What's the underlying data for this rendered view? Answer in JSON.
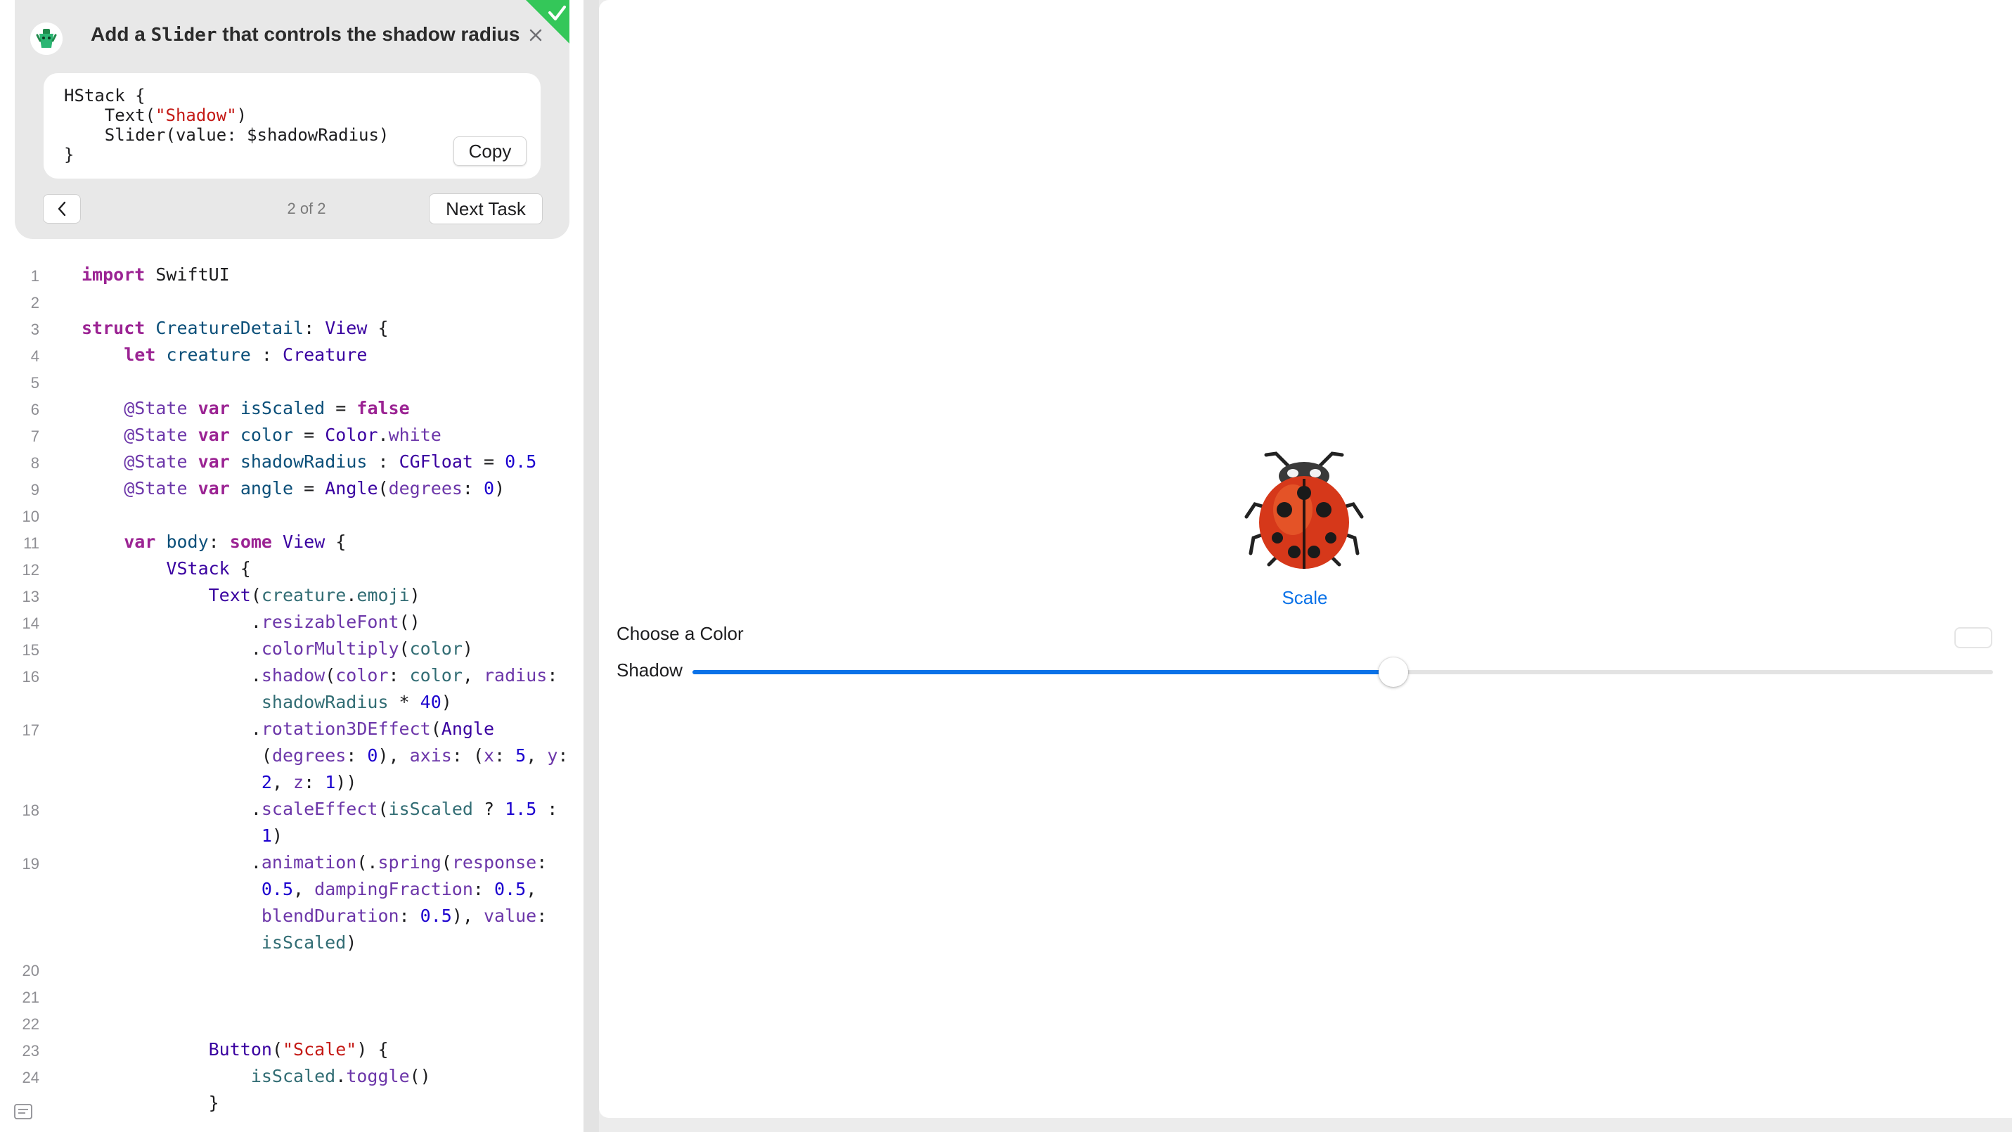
{
  "task": {
    "title_prefix": "Add a ",
    "title_code": "Slider",
    "title_suffix": " that controls the shadow radius",
    "snippet": {
      "line1": "HStack {",
      "line2_pre": "    Text(",
      "line2_str": "\"Shadow\"",
      "line2_post": ")",
      "line3": "    Slider(value: $shadowRadius)",
      "line4": "}"
    },
    "copy_label": "Copy",
    "page_indicator": "2 of 2",
    "next_label": "Next Task",
    "icons": {
      "task": "mascot-icon",
      "close": "close-icon",
      "badge": "checkmark-icon",
      "back": "chevron-left-icon"
    }
  },
  "editor": {
    "line_numbers": [
      "1",
      "2",
      "3",
      "4",
      "5",
      "6",
      "7",
      "8",
      "9",
      "10",
      "11",
      "12",
      "13",
      "14",
      "15",
      "16",
      "17",
      "18",
      "19",
      "20",
      "21",
      "22",
      "23",
      "24"
    ]
  },
  "preview": {
    "creature_emoji": "ladybug",
    "scale_label": "Scale",
    "color_label": "Choose a Color",
    "shadow_label": "Shadow",
    "shadow_slider_value": 0.5,
    "accent_color": "#0a72e8"
  },
  "colors": {
    "keyword": "#9b2393",
    "string": "#c41a16",
    "number": "#1c00cf",
    "badge": "#34c759"
  }
}
